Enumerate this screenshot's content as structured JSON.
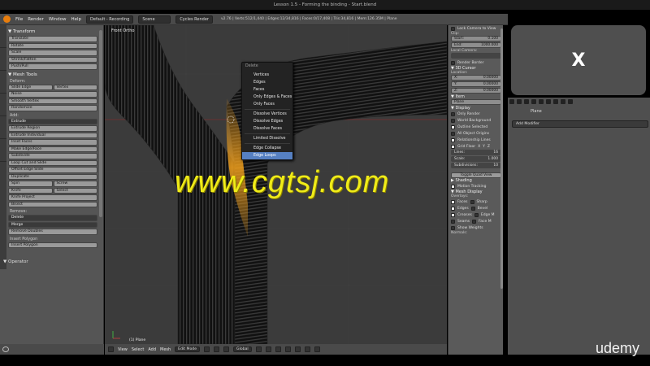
{
  "window": {
    "title": "Lesson 1.5 - Forming the binding - Start.blend"
  },
  "menubar": {
    "items": [
      "File",
      "Render",
      "Window",
      "Help"
    ],
    "layout_dropdown": "Default - Recording",
    "scene_dropdown": "Scene",
    "engine_dropdown": "Cycles Render",
    "stats": "v2.76 | Verts:512/1,440 | Edges:12/34,816 | Faces:0/17,408 | Tris:34,816 | Mem:126.35M | Plane"
  },
  "toolbar": {
    "transform_header": "Transform",
    "transform": [
      "Translate",
      "Rotate",
      "Scale",
      "Shrink/Fatten",
      "Push/Pull"
    ],
    "meshtools_header": "Mesh Tools",
    "deform_label": "Deform:",
    "slide_edge": "Slide Edge",
    "vertex": "Vertex",
    "noise": "Noise",
    "smooth_vertex": "Smooth Vertex",
    "randomize": "Randomize",
    "add_label": "Add:",
    "extrude": "Extrude",
    "add_items": [
      "Extrude Region",
      "Extrude Individual",
      "Inset Faces",
      "Make Edge/Face",
      "Subdivide",
      "Loop Cut and Slide",
      "Offset Edge Slide",
      "Duplicate"
    ],
    "spin": "Spin",
    "screw": "Screw",
    "knife": "Knife",
    "select": "Select",
    "knife_project": "Knife Project",
    "bisect": "Bisect",
    "remove_label": "Remove:",
    "delete": "Delete",
    "merge": "Merge",
    "remove_doubles": "Remove Doubles",
    "insert_polygon_label": "Insert Polygon",
    "insert_polygon": "Insert Polygon",
    "operator_header": "Operator"
  },
  "viewport": {
    "view_label": "Front Ortho",
    "object_label": "(1) Plane"
  },
  "context_menu": {
    "title": "Delete",
    "items": [
      "Vertices",
      "Edges",
      "Faces",
      "Only Edges & Faces",
      "Only Faces",
      "Dissolve Vertices",
      "Dissolve Edges",
      "Dissolve Faces",
      "Limited Dissolve",
      "Edge Collapse",
      "Edge Loops"
    ],
    "active_item": "Edge Loops"
  },
  "viewport_header": {
    "menus": [
      "View",
      "Select",
      "Add",
      "Mesh"
    ],
    "mode": "Edit Mode",
    "orientation": "Global"
  },
  "npanel": {
    "lock_camera": "Lock Camera to View",
    "clip_label": "Clip:",
    "clip_start_label": "Start:",
    "clip_start": "0.100",
    "clip_end_label": "End:",
    "clip_end": "1000.000",
    "local_camera_label": "Local Camera:",
    "render_border": "Render Border",
    "cursor_header": "3D Cursor",
    "location_label": "Location:",
    "x_label": "X:",
    "x_value": "0.00000",
    "y_label": "Y:",
    "y_value": "0.00000",
    "z_label": "Z:",
    "z_value": "0.00000",
    "item_header": "Item",
    "item_name": "Plane",
    "display_header": "Display",
    "only_render": "Only Render",
    "world_background": "World Background",
    "outline_selected": "Outline Selected",
    "all_object_origins": "All Object Origins",
    "relationship_lines": "Relationship Lines",
    "grid_floor": "Grid Floor",
    "axis_x": "X",
    "axis_y": "Y",
    "axis_z": "Z",
    "lines_label": "Lines:",
    "lines_value": "16",
    "scale_label": "Scale:",
    "scale_value": "1.000",
    "subdivisions_label": "Subdivisions:",
    "subdivisions_value": "10",
    "toggle_quad": "Toggle Quad View",
    "shading_header": "Shading",
    "motion_tracking": "Motion Tracking",
    "mesh_display_header": "Mesh Display",
    "overlays_label": "Overlays:",
    "faces": "Faces",
    "sharp": "Sharp",
    "edges": "Edges",
    "bevel": "Bevel",
    "creases": "Creases",
    "edge_marks": "Edge M",
    "seams": "Seams",
    "face_marks": "Face M",
    "show_weights": "Show Weights",
    "normals_label": "Normals:"
  },
  "outliner": {
    "close_glyph": "X"
  },
  "properties": {
    "object_name": "Plane",
    "add_modifier": "Add Modifier"
  },
  "branding": {
    "udemy": "udemy",
    "watermark": "www.cgtsj.com"
  },
  "colors": {
    "highlight": "#5680c2",
    "selected_faces": "#f2a01c",
    "watermark": "#f0ec18",
    "blender_orange": "#e87d0d"
  }
}
